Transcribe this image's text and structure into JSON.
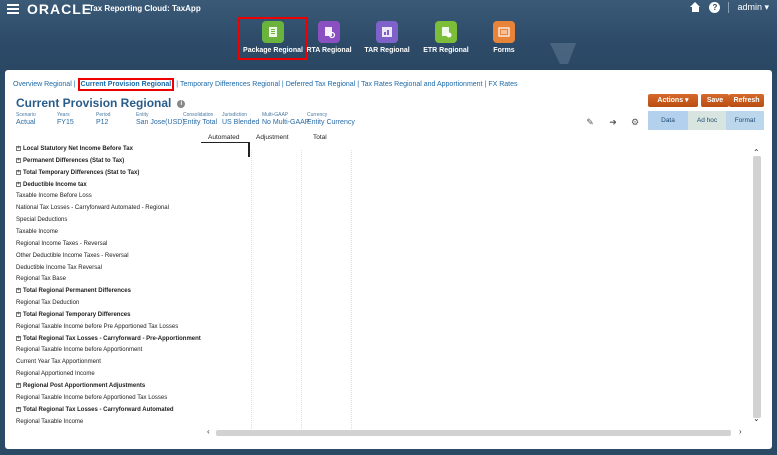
{
  "header": {
    "brand": "ORACLE",
    "app_title": "Tax Reporting Cloud: TaxApp",
    "user": "admin ▾",
    "help_glyph": "?"
  },
  "cards": [
    {
      "label": "Package Regional",
      "color": "#6ab43e",
      "icon": "package-icon"
    },
    {
      "label": "RTA Regional",
      "color": "#8a4fc0",
      "icon": "rta-icon"
    },
    {
      "label": "TAR Regional",
      "color": "#7e62c9",
      "icon": "tar-icon"
    },
    {
      "label": "ETR Regional",
      "color": "#7cbd3a",
      "icon": "etr-icon"
    },
    {
      "label": "Forms",
      "color": "#e8833a",
      "icon": "forms-icon"
    }
  ],
  "navtabs": [
    "Overview Regional",
    "Current Provision Regional",
    "Temporary Differences Regional",
    "Deferred Tax Regional",
    "Tax Rates Regional and Apportionment",
    "FX Rates"
  ],
  "page": {
    "title": "Current Provision Regional",
    "info_glyph": "i"
  },
  "pov": [
    {
      "label": "Scenario",
      "value": "Actual"
    },
    {
      "label": "Years",
      "value": "FY15"
    },
    {
      "label": "Period",
      "value": "P12"
    },
    {
      "label": "Entity",
      "value": "San Jose(USD)"
    },
    {
      "label": "Consolidation",
      "value": "Entity Total"
    },
    {
      "label": "Jurisdiction",
      "value": "US Blended"
    },
    {
      "label": "Multi-GAAP",
      "value": "No Multi-GAAP"
    },
    {
      "label": "Currency",
      "value": "Entity Currency"
    }
  ],
  "buttons": {
    "actions": "Actions ▾",
    "save": "Save",
    "refresh": "Refresh"
  },
  "view_tabs": [
    "Data",
    "Ad hoc",
    "Format"
  ],
  "columns": [
    "Automated",
    "Adjustment",
    "Total"
  ],
  "rows": [
    {
      "label": "Local Statutory Net Income Before Tax",
      "bold": true,
      "expand": true
    },
    {
      "label": "Permanent Differences (Stat to Tax)",
      "bold": true,
      "expand": true
    },
    {
      "label": "Total Temporary Differences (Stat to Tax)",
      "bold": true,
      "expand": true
    },
    {
      "label": "Deductible Income tax",
      "bold": true,
      "expand": true
    },
    {
      "label": "Taxable Income Before Loss",
      "bold": false,
      "expand": false
    },
    {
      "label": "National Tax Losses - Carryforward Automated - Regional",
      "bold": false,
      "expand": false
    },
    {
      "label": "Special Deductions",
      "bold": false,
      "expand": false
    },
    {
      "label": "Taxable Income",
      "bold": false,
      "expand": false
    },
    {
      "label": "Regional Income Taxes - Reversal",
      "bold": false,
      "expand": false
    },
    {
      "label": "Other Deductible Income Taxes - Reversal",
      "bold": false,
      "expand": false
    },
    {
      "label": "Deductible Income Tax Reversal",
      "bold": false,
      "expand": false
    },
    {
      "label": "Regional Tax Base",
      "bold": false,
      "expand": false
    },
    {
      "label": "Total Regional Permanent Differences",
      "bold": true,
      "expand": true
    },
    {
      "label": "Regional Tax Deduction",
      "bold": false,
      "expand": false
    },
    {
      "label": "Total Regional Temporary Differences",
      "bold": true,
      "expand": true
    },
    {
      "label": "Regional Taxable Income before Pre Apportioned Tax Losses",
      "bold": false,
      "expand": false
    },
    {
      "label": "Total Regional Tax Losses - Carryforward - Pre-Apportionment",
      "bold": true,
      "expand": true
    },
    {
      "label": "Regional Taxable Income before Apportionment",
      "bold": false,
      "expand": false
    },
    {
      "label": "Current Year Tax Apportionment",
      "bold": false,
      "expand": false
    },
    {
      "label": "Regional Apportioned Income",
      "bold": false,
      "expand": false
    },
    {
      "label": "Regional Post Apportionment Adjustments",
      "bold": true,
      "expand": true
    },
    {
      "label": "Regional Taxable Income before Apportioned Tax Losses",
      "bold": false,
      "expand": false
    },
    {
      "label": "Total Regional Tax Losses - Carryforward Automated",
      "bold": true,
      "expand": true
    },
    {
      "label": "Regional Taxable Income",
      "bold": false,
      "expand": false
    }
  ]
}
